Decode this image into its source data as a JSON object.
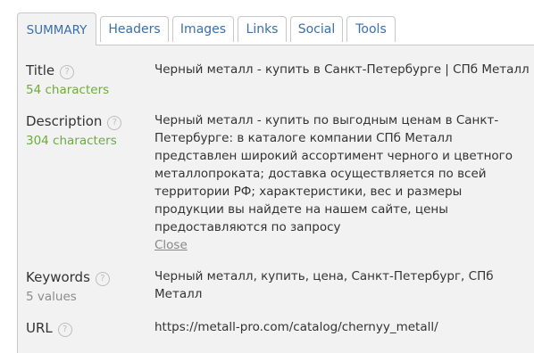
{
  "tabs": [
    {
      "label": "SUMMARY",
      "active": true
    },
    {
      "label": "Headers",
      "active": false
    },
    {
      "label": "Images",
      "active": false
    },
    {
      "label": "Links",
      "active": false
    },
    {
      "label": "Social",
      "active": false
    },
    {
      "label": "Tools",
      "active": false
    }
  ],
  "help_icon": "?",
  "fields": {
    "title": {
      "label": "Title",
      "meta": "54 characters",
      "value": "Черный металл - купить в Санкт-Петербурге | СПб Металл"
    },
    "description": {
      "label": "Description",
      "meta": "304 characters",
      "lines": [
        "Черный металл - купить по выгодным ценам в Санкт-",
        "Петербурге: в каталоге компании СПб Металл",
        "представлен широкий ассортимент черного и цветного",
        "металлопроката; доставка осуществляется по всей",
        "территории РФ; характеристики, вес и размеры",
        "продукции вы найдете на нашем сайте, цены",
        "предоставляются по запросу"
      ],
      "close_label": "Close"
    },
    "keywords": {
      "label": "Keywords",
      "meta": "5 values",
      "lines": [
        "Черный металл, купить, цена, Санкт-Петербург, СПб",
        "Металл"
      ]
    },
    "url": {
      "label": "URL",
      "value": "https://metall-pro.com/catalog/chernyy_metall/"
    }
  },
  "colors": {
    "tab_text": "#3a6fa8",
    "meta_green": "#6cab3e",
    "meta_gray": "#8c8c8c",
    "panel_bg": "#f2f2f2",
    "border": "#c8c8c8"
  }
}
